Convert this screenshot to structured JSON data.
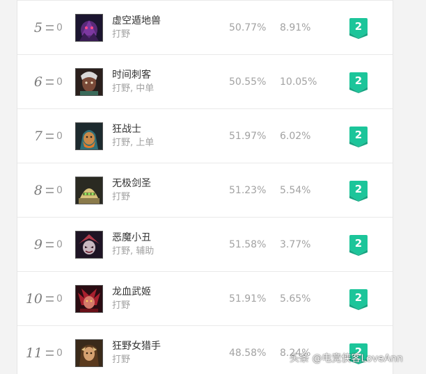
{
  "colors": {
    "tier_badge": "#1cc59a",
    "text_primary": "#333333",
    "text_secondary": "#a2a2a2",
    "rank_text": "#7b7b7b"
  },
  "rows": [
    {
      "rank": "5",
      "change": "0",
      "name": "虚空遁地兽",
      "role": "打野",
      "win_rate": "50.77%",
      "pick_rate": "8.91%",
      "tier": "2",
      "portrait_icon": "rek-sai-portrait"
    },
    {
      "rank": "6",
      "change": "0",
      "name": "时间刺客",
      "role": "打野, 中单",
      "win_rate": "50.55%",
      "pick_rate": "10.05%",
      "tier": "2",
      "portrait_icon": "ekko-portrait"
    },
    {
      "rank": "7",
      "change": "0",
      "name": "狂战士",
      "role": "打野, 上单",
      "win_rate": "51.97%",
      "pick_rate": "6.02%",
      "tier": "2",
      "portrait_icon": "olaf-portrait"
    },
    {
      "rank": "8",
      "change": "0",
      "name": "无极剑圣",
      "role": "打野",
      "win_rate": "51.23%",
      "pick_rate": "5.54%",
      "tier": "2",
      "portrait_icon": "master-yi-portrait"
    },
    {
      "rank": "9",
      "change": "0",
      "name": "恶魔小丑",
      "role": "打野, 辅助",
      "win_rate": "51.58%",
      "pick_rate": "3.77%",
      "tier": "2",
      "portrait_icon": "shaco-portrait"
    },
    {
      "rank": "10",
      "change": "0",
      "name": "龙血武姬",
      "role": "打野",
      "win_rate": "51.91%",
      "pick_rate": "5.65%",
      "tier": "2",
      "portrait_icon": "shyvana-portrait"
    },
    {
      "rank": "11",
      "change": "0",
      "name": "狂野女猎手",
      "role": "打野",
      "win_rate": "48.58%",
      "pick_rate": "8.24%",
      "tier": "2",
      "portrait_icon": "nidalee-portrait"
    }
  ],
  "watermark": "头条 @电竞侠客LoveAnn"
}
